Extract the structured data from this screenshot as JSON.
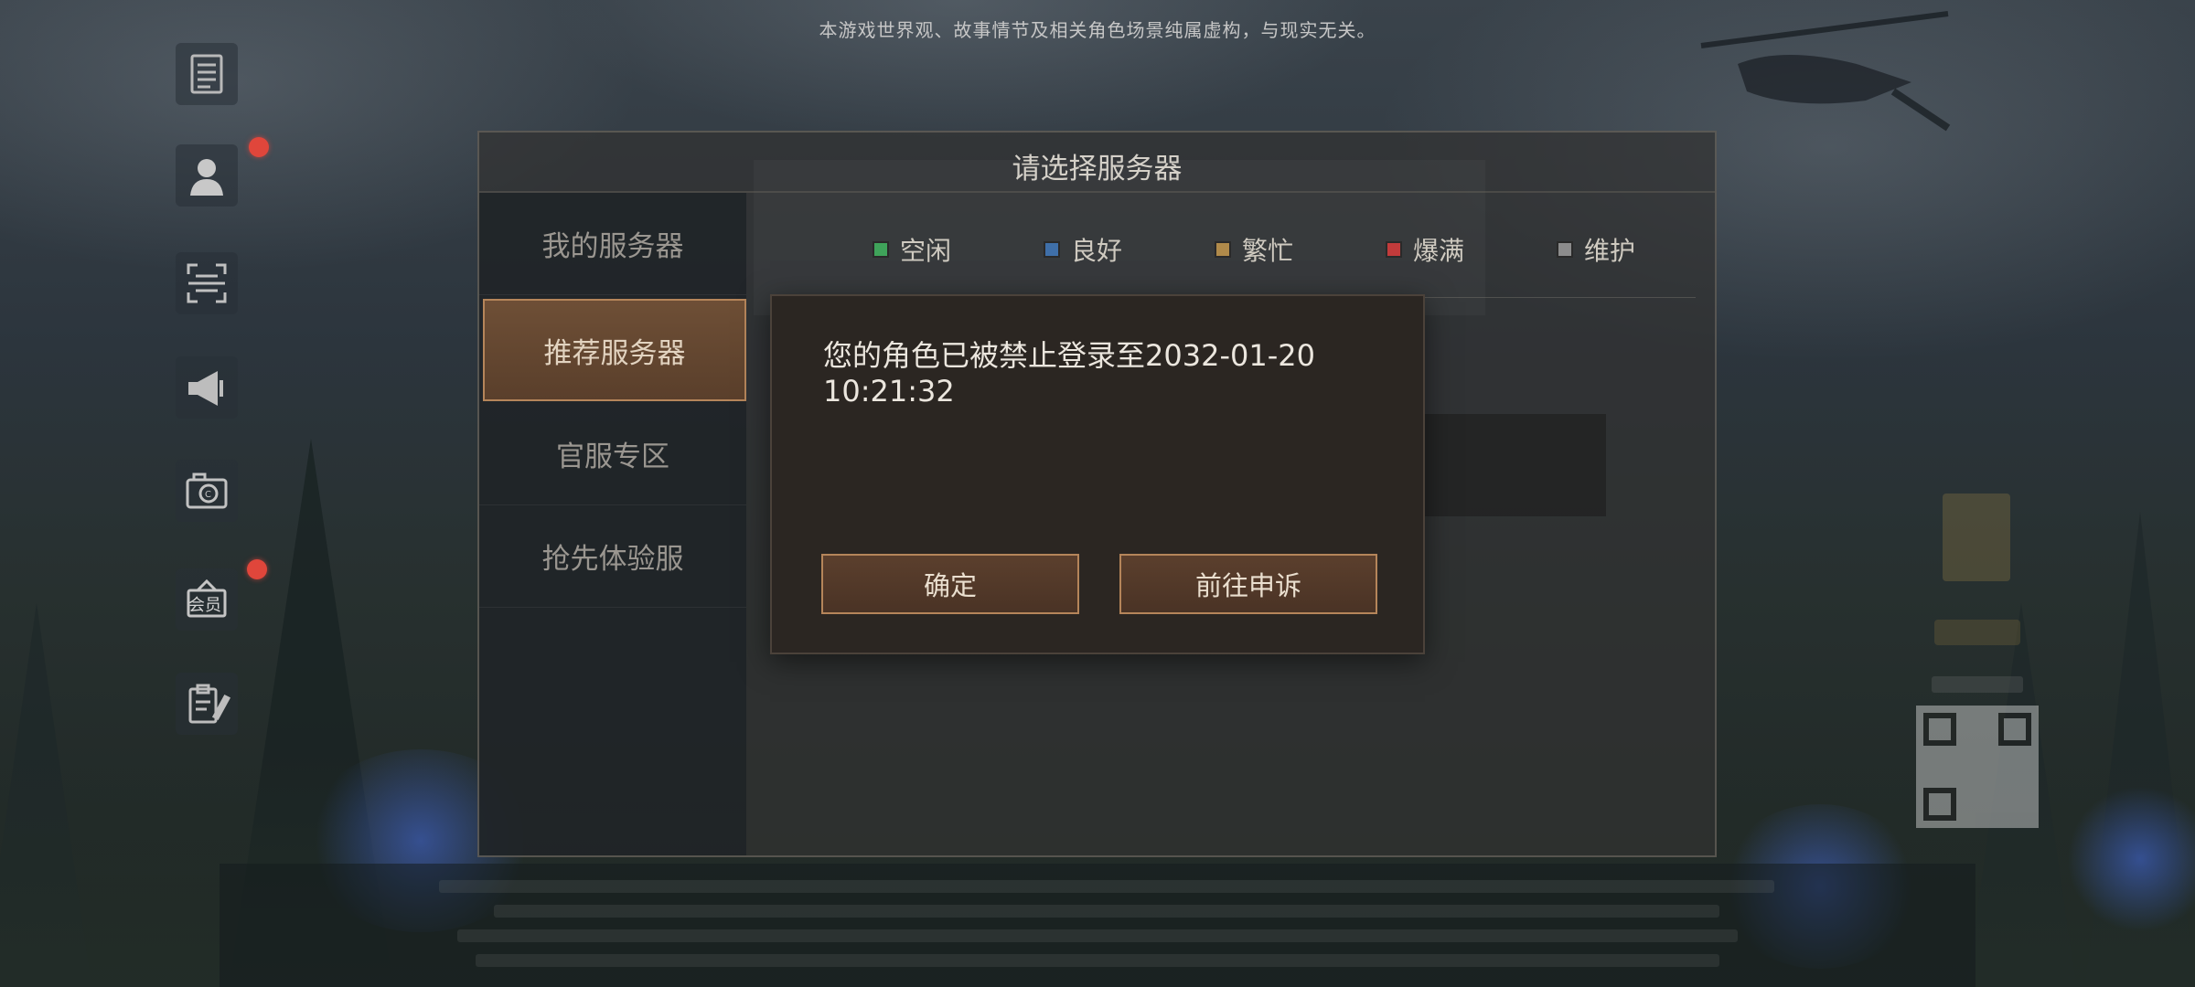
{
  "notice": "本游戏世界观、故事情节及相关角色场景纯属虚构，与现实无关。",
  "rail_icons": [
    {
      "name": "announcement-icon",
      "badge": false
    },
    {
      "name": "account-icon",
      "badge": true
    },
    {
      "name": "scan-icon",
      "badge": false
    },
    {
      "name": "megaphone-icon",
      "badge": false
    },
    {
      "name": "camera-icon",
      "badge": false
    },
    {
      "name": "membership-icon",
      "badge": true,
      "text": "会员"
    },
    {
      "name": "survey-icon",
      "badge": false
    }
  ],
  "panel": {
    "title": "请选择服务器",
    "tabs": [
      {
        "label": "我的服务器",
        "active": false
      },
      {
        "label": "推荐服务器",
        "active": true
      },
      {
        "label": "官服专区",
        "active": false
      },
      {
        "label": "抢先体验服",
        "active": false
      }
    ],
    "legend": [
      {
        "label": "空闲",
        "color": "#3fa35a"
      },
      {
        "label": "良好",
        "color": "#3f6fa8"
      },
      {
        "label": "繁忙",
        "color": "#b08a4a"
      },
      {
        "label": "爆满",
        "color": "#c23b3b"
      },
      {
        "label": "维护",
        "color": "#8c8c8c"
      }
    ]
  },
  "dialog": {
    "message": "您的角色已被禁止登录至2032-01-20 10:21:32",
    "confirm_label": "确定",
    "appeal_label": "前往申诉"
  },
  "colors": {
    "accent_border": "#b5855a",
    "active_tab": "#6e4f36",
    "badge_red": "#e0463b"
  }
}
